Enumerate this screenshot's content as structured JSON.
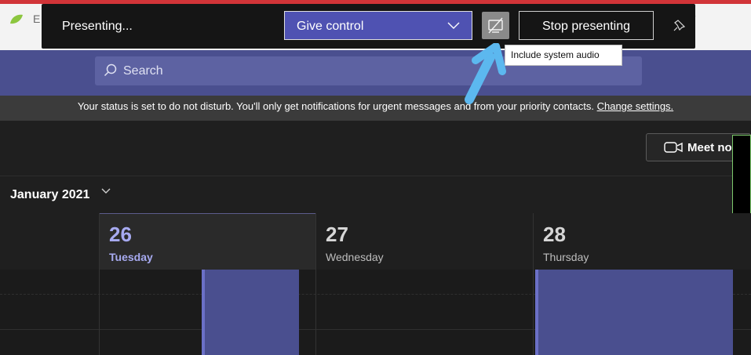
{
  "browser": {
    "tab_letter": "E",
    "right_icon": "☆"
  },
  "presenting_bar": {
    "status": "Presenting...",
    "give_control": {
      "label": "Give control"
    },
    "audio_toggle_icon": "system-audio-off-icon",
    "stop_label": "Stop presenting",
    "pin_icon": "pin-icon"
  },
  "tooltip": {
    "text": "Include system audio"
  },
  "header": {
    "search": {
      "placeholder": "Search"
    }
  },
  "banner": {
    "text": "Your status is set to do not disturb. You'll only get notifications for urgent messages and from your priority contacts.",
    "link": "Change settings."
  },
  "toolbar": {
    "meet_now_label": "Meet no"
  },
  "calendar": {
    "month": "January 2021",
    "days": [
      {
        "num": "26",
        "name": "Tuesday",
        "today": true
      },
      {
        "num": "27",
        "name": "Wednesday",
        "today": false
      },
      {
        "num": "28",
        "name": "Thursday",
        "today": false
      }
    ]
  },
  "colors": {
    "accent": "#4f52b2",
    "header": "#4a4f8f",
    "today": "#a7aaf0",
    "arrow": "#5cb8ef",
    "alert_line": "#d13438"
  }
}
